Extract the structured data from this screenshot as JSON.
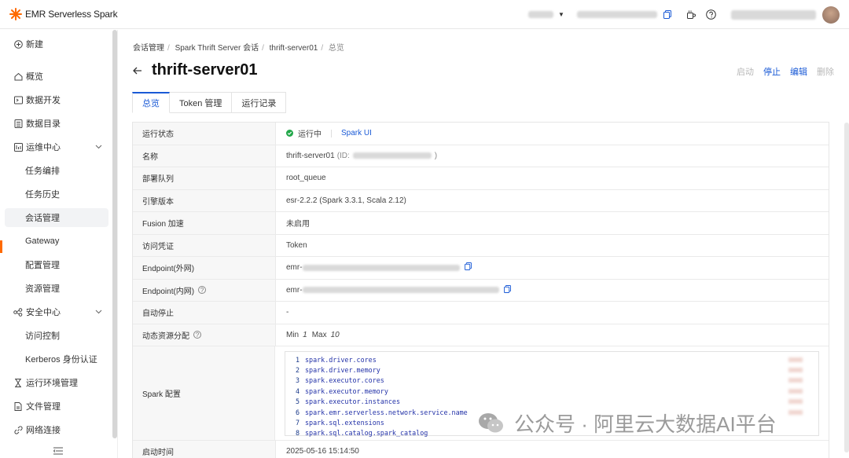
{
  "app": {
    "name": "EMR Serverless Spark",
    "brand_color": "#ff6a00",
    "accent": "#1a5ad6"
  },
  "sidebar": {
    "items": [
      {
        "label": "新建",
        "icon": "plus-circle-icon"
      },
      {
        "label": "概览",
        "icon": "home-icon"
      },
      {
        "label": "数据开发",
        "icon": "terminal-icon"
      },
      {
        "label": "数据目录",
        "icon": "catalog-icon"
      },
      {
        "label": "运维中心",
        "icon": "ops-icon"
      },
      {
        "label": "任务编排"
      },
      {
        "label": "任务历史"
      },
      {
        "label": "会话管理"
      },
      {
        "label": "Gateway"
      },
      {
        "label": "配置管理"
      },
      {
        "label": "资源管理"
      },
      {
        "label": "安全中心",
        "icon": "security-icon"
      },
      {
        "label": "访问控制"
      },
      {
        "label": "Kerberos 身份认证"
      },
      {
        "label": "运行环境管理",
        "icon": "hourglass-icon"
      },
      {
        "label": "文件管理",
        "icon": "file-icon"
      },
      {
        "label": "网络连接",
        "icon": "link-icon"
      }
    ]
  },
  "breadcrumb": [
    "会话管理",
    "Spark Thrift Server 会话",
    "thrift-server01",
    "总览"
  ],
  "page": {
    "title": "thrift-server01"
  },
  "actions": {
    "start": "启动",
    "stop": "停止",
    "edit": "编辑",
    "delete": "删除"
  },
  "tabs": [
    "总览",
    "Token 管理",
    "运行记录"
  ],
  "details": {
    "status": {
      "label": "运行状态",
      "value": "运行中",
      "spark_ui": "Spark UI"
    },
    "name": {
      "label": "名称",
      "value": "thrift-server01",
      "id_prefix": "(ID:",
      "id_suffix": ")"
    },
    "queue": {
      "label": "部署队列",
      "value": "root_queue"
    },
    "engine": {
      "label": "引擎版本",
      "value": "esr-2.2.2 (Spark 3.3.1, Scala 2.12)"
    },
    "fusion": {
      "label": "Fusion 加速",
      "value": "未启用"
    },
    "credential": {
      "label": "访问凭证",
      "value": "Token"
    },
    "endpoint_public": {
      "label": "Endpoint(外网)",
      "value": "emr-"
    },
    "endpoint_private": {
      "label": "Endpoint(内网)",
      "value": "emr-"
    },
    "auto_stop": {
      "label": "自动停止",
      "value": "-"
    },
    "dynamic": {
      "label": "动态资源分配",
      "min_label": "Min",
      "min": "1",
      "max_label": "Max",
      "max": "10"
    },
    "spark_conf": {
      "label": "Spark 配置",
      "lines": [
        "spark.driver.cores",
        "spark.driver.memory",
        "spark.executor.cores",
        "spark.executor.memory",
        "spark.executor.instances",
        "spark.emr.serverless.network.service.name",
        "spark.sql.extensions",
        "spark.sql.catalog.spark_catalog"
      ]
    },
    "start_time": {
      "label": "启动时间",
      "value": "2025-05-16 15:14:50"
    }
  },
  "watermark": {
    "text": "公众号 · 阿里云大数据AI平台"
  }
}
